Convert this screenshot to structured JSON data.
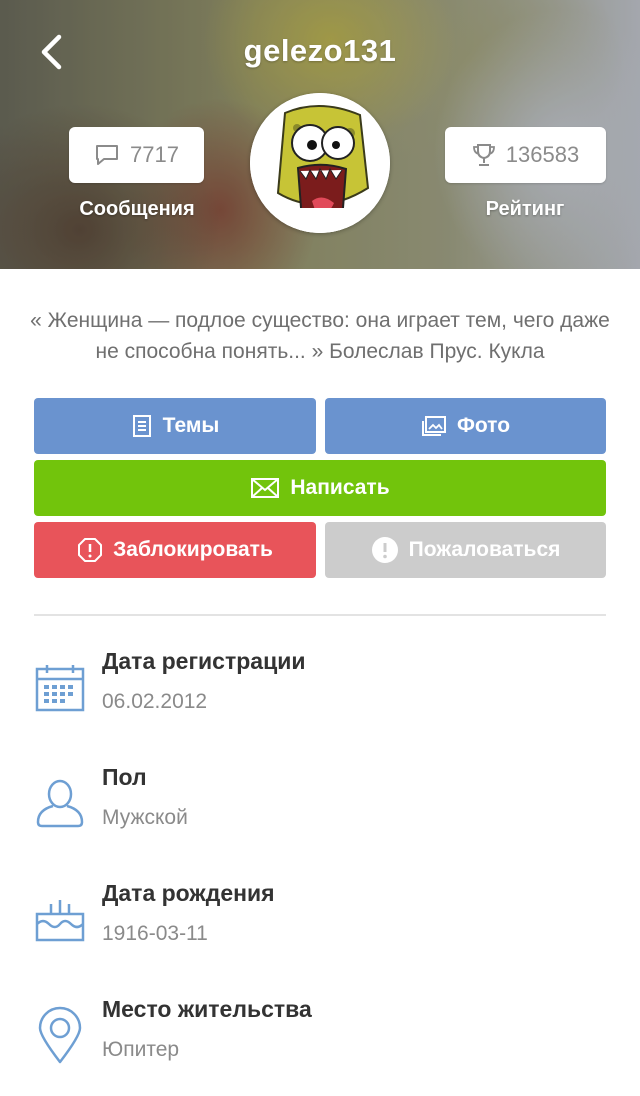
{
  "header": {
    "username": "gelezo131",
    "messages": {
      "count": "7717",
      "label": "Сообщения"
    },
    "rating": {
      "count": "136583",
      "label": "Рейтинг"
    }
  },
  "quote": "« Женщина — подлое существо: она играет тем, чего даже не способна понять... »  Болеслав Прус. Кукла",
  "buttons": {
    "topics": "Темы",
    "photo": "Фото",
    "write": "Написать",
    "block": "Заблокировать",
    "report": "Пожаловаться"
  },
  "colors": {
    "blue": "#6a93cf",
    "green": "#72c40c",
    "red": "#e8545a",
    "gray": "#cccccc",
    "icon_blue": "#6e9fd3"
  },
  "info": [
    {
      "title": "Дата регистрации",
      "value": "06.02.2012",
      "icon": "calendar-icon"
    },
    {
      "title": "Пол",
      "value": "Мужской",
      "icon": "user-icon"
    },
    {
      "title": "Дата рождения",
      "value": "1916-03-11",
      "icon": "birthday-cake-icon"
    },
    {
      "title": "Место жительства",
      "value": "Юпитер",
      "icon": "location-pin-icon"
    }
  ]
}
